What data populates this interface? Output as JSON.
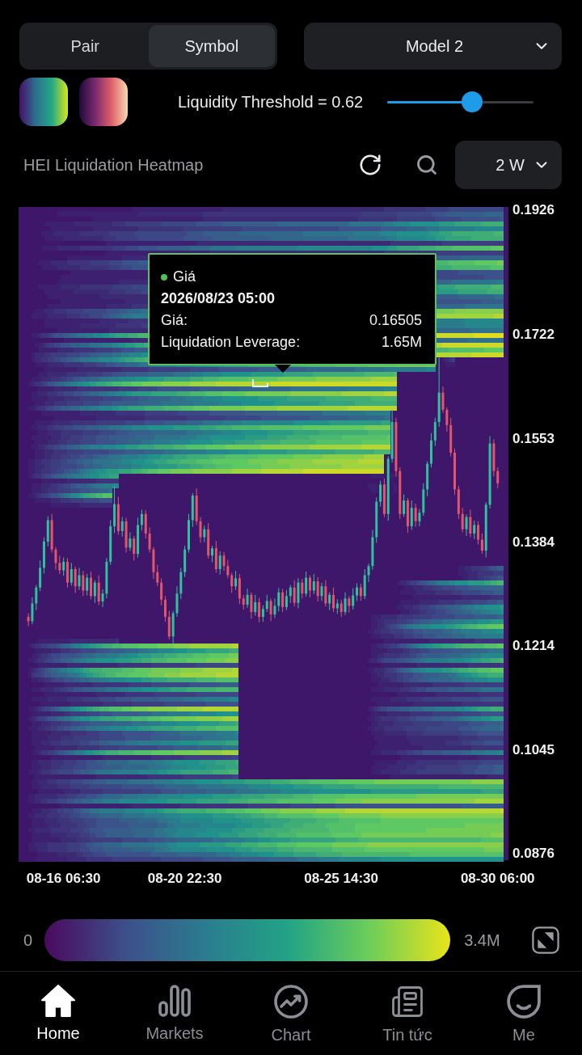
{
  "source_toggle": [
    {
      "label": "Pair",
      "selected": false
    },
    {
      "label": "Symbol",
      "selected": true
    }
  ],
  "model_select": {
    "value": "Model 2"
  },
  "color_schemes": [
    {
      "kind": "viridis"
    },
    {
      "kind": "magma"
    }
  ],
  "threshold": {
    "label": "Liquidity Threshold = 0.62",
    "level": 0.58
  },
  "heatmap_header": {
    "title": "HEI Liquidation Heatmap",
    "range_select": {
      "value": "2 W"
    }
  },
  "heatmap": {
    "chart_data": {
      "type": "candlestick",
      "categories": [
        null,
        null,
        null,
        null,
        null,
        null,
        null,
        null,
        null,
        null,
        null,
        "08-16 06:30",
        null,
        null,
        null,
        null,
        null,
        null,
        null,
        null,
        null,
        null,
        null,
        null,
        null,
        null,
        null,
        null,
        null,
        null,
        null,
        null,
        null,
        null,
        null,
        null,
        null,
        null,
        null,
        null,
        null,
        null,
        "08-20 22:30",
        null,
        null,
        null,
        null,
        null,
        null,
        null,
        null,
        null,
        null,
        null,
        null,
        null,
        null,
        null,
        null,
        null,
        null,
        null,
        null,
        null,
        null,
        null,
        null,
        null,
        null,
        null,
        null,
        null,
        null,
        null,
        null,
        null,
        null,
        null,
        null,
        null,
        null,
        null,
        "08-25 14:30",
        null,
        null,
        null,
        null,
        null,
        null,
        null,
        null,
        null,
        null,
        null,
        null,
        null,
        null,
        null,
        null,
        null,
        null,
        null,
        null,
        null,
        null,
        null,
        null,
        null,
        null,
        null,
        null,
        null,
        null,
        null,
        null,
        null,
        null,
        null,
        null,
        null,
        null,
        null,
        "08-30 06:00",
        null
      ],
      "ohlc": [
        null,
        null,
        [
          0.1262,
          0.1268,
          0.1247,
          0.1255
        ],
        [
          0.1255,
          0.1294,
          0.125,
          0.1284
        ],
        [
          0.1284,
          0.1314,
          0.1273,
          0.131
        ],
        [
          0.131,
          0.1354,
          0.1304,
          0.1342
        ],
        [
          0.1342,
          0.1392,
          0.1333,
          0.1385
        ],
        [
          0.1385,
          0.1426,
          0.1377,
          0.142
        ],
        [
          0.142,
          0.143,
          0.1367,
          0.1372
        ],
        [
          0.1372,
          0.1376,
          0.1339,
          0.135
        ],
        [
          0.135,
          0.1362,
          0.1332,
          0.1338
        ],
        [
          0.1338,
          0.1359,
          0.1329,
          0.1352
        ],
        [
          0.1352,
          0.1358,
          0.131,
          0.1318
        ],
        [
          0.1318,
          0.135,
          0.1313,
          0.134
        ],
        [
          0.134,
          0.1344,
          0.1301,
          0.1312
        ],
        [
          0.1312,
          0.1342,
          0.1306,
          0.133
        ],
        [
          0.133,
          0.1337,
          0.1296,
          0.1305
        ],
        [
          0.1305,
          0.1332,
          0.1297,
          0.1326
        ],
        [
          0.1326,
          0.1336,
          0.1291,
          0.1296
        ],
        [
          0.1296,
          0.1322,
          0.1285,
          0.1318
        ],
        [
          0.1318,
          0.133,
          0.1281,
          0.1287
        ],
        [
          0.1287,
          0.1307,
          0.1278,
          0.13
        ],
        [
          0.13,
          0.1358,
          0.1292,
          0.1352
        ],
        [
          0.1352,
          0.142,
          0.1347,
          0.141
        ],
        [
          0.141,
          0.1475,
          0.1399,
          0.1446
        ],
        [
          0.1446,
          0.1458,
          0.1396,
          0.1402
        ],
        [
          0.1402,
          0.1425,
          0.1393,
          0.1418
        ],
        [
          0.1418,
          0.1424,
          0.1367,
          0.1375
        ],
        [
          0.1375,
          0.14,
          0.137,
          0.139
        ],
        [
          0.139,
          0.1394,
          0.1354,
          0.1365
        ],
        [
          0.1365,
          0.1424,
          0.1359,
          0.1412
        ],
        [
          0.1412,
          0.1437,
          0.1403,
          0.143
        ],
        [
          0.143,
          0.1436,
          0.139,
          0.1398
        ],
        [
          0.1398,
          0.1408,
          0.1367,
          0.1372
        ],
        [
          0.1372,
          0.1376,
          0.1324,
          0.1335
        ],
        [
          0.1335,
          0.1347,
          0.1312,
          0.1318
        ],
        [
          0.1318,
          0.1325,
          0.1281,
          0.129
        ],
        [
          0.129,
          0.1296,
          0.1254,
          0.1262
        ],
        [
          0.1262,
          0.1272,
          0.1225,
          0.123
        ],
        [
          0.123,
          0.1272,
          0.1219,
          0.1268
        ],
        [
          0.1268,
          0.1312,
          0.1262,
          0.13
        ],
        [
          0.13,
          0.1342,
          0.1291,
          0.1335
        ],
        [
          0.1335,
          0.1378,
          0.1327,
          0.1372
        ],
        [
          0.1372,
          0.143,
          0.1367,
          0.142
        ],
        [
          0.142,
          0.1464,
          0.1409,
          0.146
        ],
        [
          0.146,
          0.1472,
          0.1412,
          0.1418
        ],
        [
          0.1418,
          0.1425,
          0.1383,
          0.1392
        ],
        [
          0.1392,
          0.1411,
          0.1384,
          0.1405
        ],
        [
          0.1405,
          0.1415,
          0.1357,
          0.1362
        ],
        [
          0.1362,
          0.1378,
          0.1351,
          0.1374
        ],
        [
          0.1374,
          0.1386,
          0.1334,
          0.134
        ],
        [
          0.134,
          0.1369,
          0.1331,
          0.1362
        ],
        [
          0.1362,
          0.1368,
          0.1337,
          0.1345
        ],
        [
          0.1345,
          0.1355,
          0.1325,
          0.133
        ],
        [
          0.133,
          0.1334,
          0.1301,
          0.1312
        ],
        [
          0.1312,
          0.1337,
          0.1306,
          0.1325
        ],
        [
          0.1325,
          0.1332,
          0.1283,
          0.1292
        ],
        [
          0.1292,
          0.1298,
          0.1274,
          0.1282
        ],
        [
          0.1282,
          0.1308,
          0.1277,
          0.1298
        ],
        [
          0.1298,
          0.1302,
          0.1259,
          0.127
        ],
        [
          0.127,
          0.1298,
          0.1264,
          0.1286
        ],
        [
          0.1286,
          0.1293,
          0.1253,
          0.1262
        ],
        [
          0.1262,
          0.1281,
          0.1254,
          0.1275
        ],
        [
          0.1275,
          0.1298,
          0.127,
          0.1288
        ],
        [
          0.1288,
          0.1292,
          0.1255,
          0.1266
        ],
        [
          0.1266,
          0.1292,
          0.126,
          0.128
        ],
        [
          0.128,
          0.1309,
          0.1271,
          0.1302
        ],
        [
          0.1302,
          0.1308,
          0.127,
          0.1278
        ],
        [
          0.1278,
          0.1306,
          0.1273,
          0.1296
        ],
        [
          0.1296,
          0.1314,
          0.1285,
          0.131
        ],
        [
          0.131,
          0.1322,
          0.1279,
          0.1285
        ],
        [
          0.1285,
          0.1325,
          0.1276,
          0.1318
        ],
        [
          0.1318,
          0.1324,
          0.1292,
          0.13
        ],
        [
          0.13,
          0.1336,
          0.1295,
          0.1326
        ],
        [
          0.1326,
          0.133,
          0.1294,
          0.1305
        ],
        [
          0.1305,
          0.1332,
          0.1299,
          0.132
        ],
        [
          0.132,
          0.1327,
          0.1287,
          0.1296
        ],
        [
          0.1296,
          0.1318,
          0.1288,
          0.1312
        ],
        [
          0.1312,
          0.1322,
          0.1279,
          0.1284
        ],
        [
          0.1284,
          0.1302,
          0.1273,
          0.1298
        ],
        [
          0.1298,
          0.131,
          0.127,
          0.1276
        ],
        [
          0.1276,
          0.1291,
          0.1267,
          0.1284
        ],
        [
          0.1284,
          0.129,
          0.1262,
          0.127
        ],
        [
          0.127,
          0.1302,
          0.1265,
          0.1292
        ],
        [
          0.1292,
          0.1296,
          0.1269,
          0.128
        ],
        [
          0.128,
          0.1309,
          0.1274,
          0.1297
        ],
        [
          0.1297,
          0.1317,
          0.1288,
          0.131
        ],
        [
          0.131,
          0.1316,
          0.1288,
          0.1296
        ],
        [
          0.1296,
          0.134,
          0.1291,
          0.133
        ],
        [
          0.133,
          0.1349,
          0.1319,
          0.1345
        ],
        [
          0.1345,
          0.1404,
          0.1339,
          0.1392
        ],
        [
          0.1392,
          0.1457,
          0.1383,
          0.145
        ],
        [
          0.145,
          0.1484,
          0.1442,
          0.1478
        ],
        [
          0.1478,
          0.1488,
          0.1425,
          0.143
        ],
        [
          0.143,
          0.1524,
          0.1419,
          0.152
        ],
        [
          0.152,
          0.16,
          0.1514,
          0.158
        ],
        [
          0.158,
          0.1587,
          0.1491,
          0.15
        ],
        [
          0.15,
          0.1506,
          0.1422,
          0.143
        ],
        [
          0.143,
          0.1462,
          0.1425,
          0.1452
        ],
        [
          0.1452,
          0.1456,
          0.1399,
          0.141
        ],
        [
          0.141,
          0.1452,
          0.1404,
          0.144
        ],
        [
          0.144,
          0.1447,
          0.1409,
          0.1418
        ],
        [
          0.1418,
          0.1438,
          0.141,
          0.1432
        ],
        [
          0.1432,
          0.148,
          0.1427,
          0.147
        ],
        [
          0.147,
          0.1516,
          0.1459,
          0.1512
        ],
        [
          0.1512,
          0.1562,
          0.1506,
          0.155
        ],
        [
          0.155,
          0.1587,
          0.1541,
          0.158
        ],
        [
          0.158,
          0.1685,
          0.1572,
          0.1628
        ],
        [
          0.1628,
          0.1638,
          0.1595,
          0.16
        ],
        [
          0.16,
          0.1604,
          0.1564,
          0.1575
        ],
        [
          0.1575,
          0.1587,
          0.1524,
          0.153
        ],
        [
          0.153,
          0.1537,
          0.1461,
          0.147
        ],
        [
          0.147,
          0.1476,
          0.1422,
          0.143
        ],
        [
          0.143,
          0.144,
          0.14,
          0.1405
        ],
        [
          0.1405,
          0.1429,
          0.1394,
          0.1425
        ],
        [
          0.1425,
          0.1437,
          0.1392,
          0.1398
        ],
        [
          0.1398,
          0.1419,
          0.1389,
          0.1412
        ],
        [
          0.1412,
          0.1418,
          0.138,
          0.1388
        ],
        [
          0.1388,
          0.1398,
          0.1365,
          0.137
        ],
        [
          0.137,
          0.1449,
          0.1359,
          0.1445
        ],
        [
          0.1445,
          0.1557,
          0.1439,
          0.1545
        ],
        [
          0.1545,
          0.1552,
          0.1491,
          0.15
        ],
        [
          0.15,
          0.1506,
          0.1472,
          0.148
        ],
        null
      ],
      "ylim": [
        0.0865,
        0.1931
      ],
      "yticks": [
        {
          "value": 0.1926,
          "label": "0.1926"
        },
        {
          "value": 0.1722,
          "label": "0.1722"
        },
        {
          "value": 0.1553,
          "label": "0.1553"
        },
        {
          "value": 0.1384,
          "label": "0.1384"
        },
        {
          "value": 0.1214,
          "label": "0.1214"
        },
        {
          "value": 0.1045,
          "label": "0.1045"
        },
        {
          "value": 0.0876,
          "label": "0.0876"
        }
      ]
    },
    "tooltip": {
      "series": "Giá",
      "time": "2026/08/23 05:00",
      "rows": [
        {
          "label": "Giá:",
          "value": "0.16505"
        },
        {
          "label": "Liquidation Leverage:",
          "value": "1.65M"
        }
      ]
    }
  },
  "color_scale": {
    "min": "0",
    "max": "3.4M"
  },
  "bottom_nav": [
    {
      "kind": "home",
      "label": "Home",
      "selected": true
    },
    {
      "kind": "markets",
      "label": "Markets",
      "selected": false
    },
    {
      "kind": "chart",
      "label": "Chart",
      "selected": false
    },
    {
      "kind": "news",
      "label": "Tin tức",
      "selected": false
    },
    {
      "kind": "profile",
      "label": "Me",
      "selected": false
    }
  ]
}
